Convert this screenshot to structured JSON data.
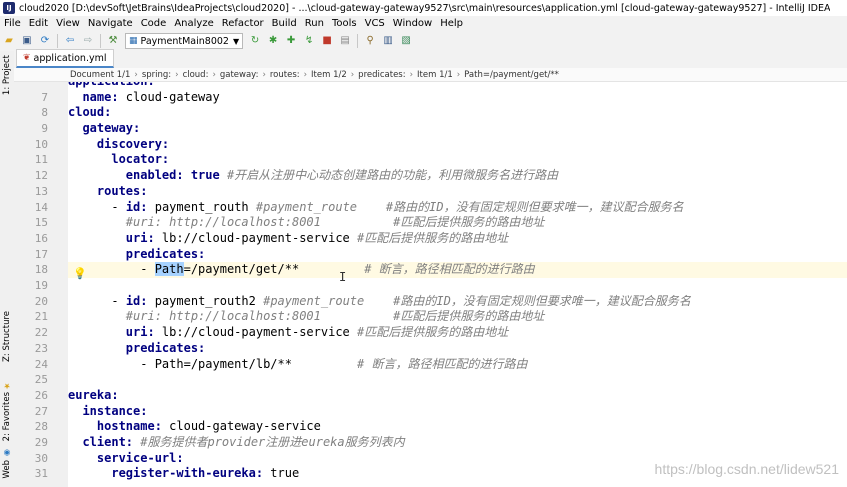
{
  "window": {
    "title": "cloud2020 [D:\\devSoft\\JetBrains\\IdeaProjects\\cloud2020] - ...\\cloud-gateway-gateway9527\\src\\main\\resources\\application.yml [cloud-gateway-gateway9527] - IntelliJ IDEA"
  },
  "menu": [
    "File",
    "Edit",
    "View",
    "Navigate",
    "Code",
    "Analyze",
    "Refactor",
    "Build",
    "Run",
    "Tools",
    "VCS",
    "Window",
    "Help"
  ],
  "toolbar": {
    "run_config": "PaymentMain8002"
  },
  "left_panels": {
    "project": "1: Project",
    "structure": "Z: Structure",
    "favorites": "2: Favorites",
    "web": "Web"
  },
  "tab": {
    "label": "application.yml"
  },
  "breadcrumb": [
    "Document 1/1",
    "spring:",
    "cloud:",
    "gateway:",
    "routes:",
    "Item 1/2",
    "predicates:",
    "Item 1/1",
    "Path=/payment/get/**"
  ],
  "editor": {
    "lines": [
      {
        "n": "7",
        "indent": "  ",
        "parts": [
          {
            "t": "k",
            "s": "name:"
          },
          {
            "t": "v",
            "s": " cloud-gateway"
          }
        ]
      },
      {
        "n": "8",
        "indent": "",
        "parts": [
          {
            "t": "k",
            "s": "cloud:"
          }
        ]
      },
      {
        "n": "9",
        "indent": "  ",
        "parts": [
          {
            "t": "k",
            "s": "gateway:"
          }
        ]
      },
      {
        "n": "10",
        "indent": "    ",
        "parts": [
          {
            "t": "k",
            "s": "discovery:"
          }
        ]
      },
      {
        "n": "11",
        "indent": "      ",
        "parts": [
          {
            "t": "k",
            "s": "locator:"
          }
        ]
      },
      {
        "n": "12",
        "indent": "        ",
        "parts": [
          {
            "t": "k",
            "s": "enabled:"
          },
          {
            "t": "kw",
            "s": " true"
          },
          {
            "t": "c",
            "s": " #开启从注册中心动态创建路由的功能，利用微服务名进行路由"
          }
        ]
      },
      {
        "n": "13",
        "indent": "    ",
        "parts": [
          {
            "t": "k",
            "s": "routes:"
          }
        ]
      },
      {
        "n": "14",
        "indent": "      ",
        "parts": [
          {
            "t": "v",
            "s": "- "
          },
          {
            "t": "k",
            "s": "id:"
          },
          {
            "t": "v",
            "s": " payment_routh "
          },
          {
            "t": "c",
            "s": "#payment_route    #路由的ID，没有固定规则但要求唯一，建议配合服务名"
          }
        ]
      },
      {
        "n": "15",
        "indent": "        ",
        "parts": [
          {
            "t": "c",
            "s": "#uri: http://localhost:8001          #匹配后提供服务的路由地址"
          }
        ]
      },
      {
        "n": "16",
        "indent": "        ",
        "parts": [
          {
            "t": "k",
            "s": "uri:"
          },
          {
            "t": "v",
            "s": " lb://cloud-payment-service "
          },
          {
            "t": "c",
            "s": "#匹配后提供服务的路由地址"
          }
        ]
      },
      {
        "n": "17",
        "indent": "        ",
        "parts": [
          {
            "t": "k",
            "s": "predicates:"
          }
        ]
      },
      {
        "n": "18",
        "indent": "          ",
        "parts": [
          {
            "t": "v",
            "s": "- "
          },
          {
            "t": "sel",
            "s": "Path"
          },
          {
            "t": "v",
            "s": "=/payment/get/**         "
          },
          {
            "t": "c",
            "s": "# 断言，路径相匹配的进行路由"
          }
        ],
        "current": true
      },
      {
        "n": "19",
        "indent": "",
        "parts": []
      },
      {
        "n": "20",
        "indent": "      ",
        "parts": [
          {
            "t": "v",
            "s": "- "
          },
          {
            "t": "k",
            "s": "id:"
          },
          {
            "t": "v",
            "s": " payment_routh2 "
          },
          {
            "t": "c",
            "s": "#payment_route    #路由的ID，没有固定规则但要求唯一，建议配合服务名"
          }
        ]
      },
      {
        "n": "21",
        "indent": "        ",
        "parts": [
          {
            "t": "c",
            "s": "#uri: http://localhost:8001          #匹配后提供服务的路由地址"
          }
        ]
      },
      {
        "n": "22",
        "indent": "        ",
        "parts": [
          {
            "t": "k",
            "s": "uri:"
          },
          {
            "t": "v",
            "s": " lb://cloud-payment-service "
          },
          {
            "t": "c",
            "s": "#匹配后提供服务的路由地址"
          }
        ]
      },
      {
        "n": "23",
        "indent": "        ",
        "parts": [
          {
            "t": "k",
            "s": "predicates:"
          }
        ]
      },
      {
        "n": "24",
        "indent": "          ",
        "parts": [
          {
            "t": "v",
            "s": "- Path=/payment/lb/**         "
          },
          {
            "t": "c",
            "s": "# 断言，路径相匹配的进行路由"
          }
        ]
      },
      {
        "n": "25",
        "indent": "",
        "parts": []
      },
      {
        "n": "26",
        "indent": "",
        "parts": [
          {
            "t": "k",
            "s": "eureka:"
          }
        ]
      },
      {
        "n": "27",
        "indent": "  ",
        "parts": [
          {
            "t": "k",
            "s": "instance:"
          }
        ]
      },
      {
        "n": "28",
        "indent": "    ",
        "parts": [
          {
            "t": "k",
            "s": "hostname:"
          },
          {
            "t": "v",
            "s": " cloud-gateway-service"
          }
        ]
      },
      {
        "n": "29",
        "indent": "  ",
        "parts": [
          {
            "t": "k",
            "s": "client:"
          },
          {
            "t": "c",
            "s": " #服务提供者provider注册进eureka服务列表内"
          }
        ]
      },
      {
        "n": "30",
        "indent": "    ",
        "parts": [
          {
            "t": "k",
            "s": "service-url:"
          }
        ]
      },
      {
        "n": "31",
        "indent": "      ",
        "parts": [
          {
            "t": "k",
            "s": "register-with-eureka:"
          },
          {
            "t": "v",
            "s": " true"
          }
        ]
      }
    ]
  },
  "watermark": "https://blog.csdn.net/lidew521"
}
